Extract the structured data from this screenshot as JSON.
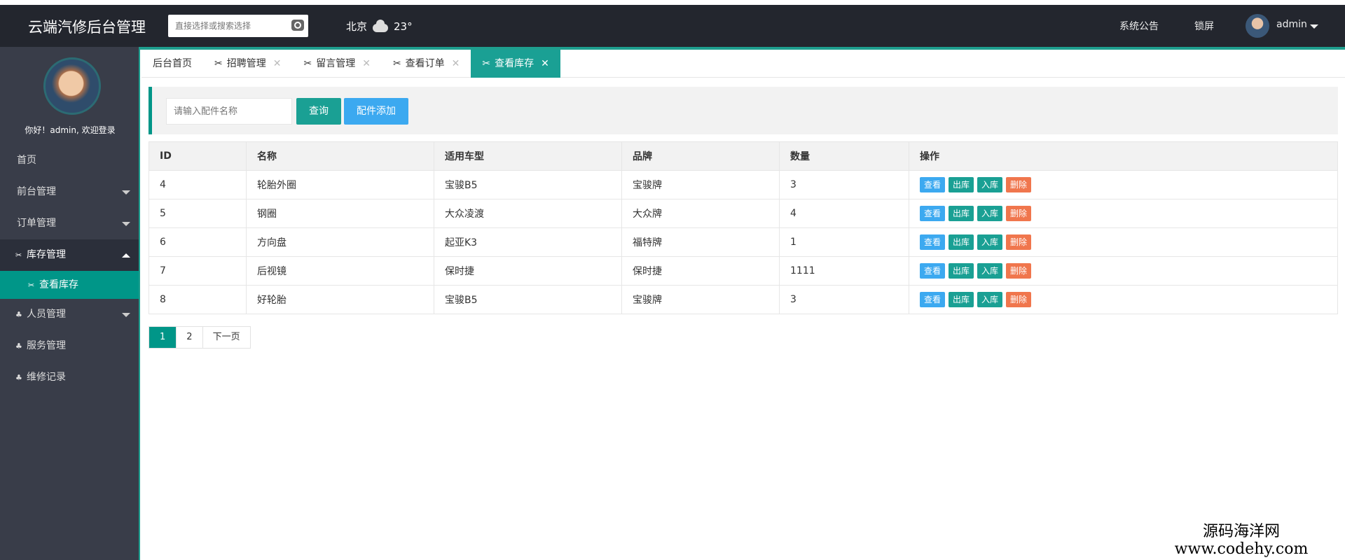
{
  "app": {
    "title": "云端汽修后台管理"
  },
  "header": {
    "search_placeholder": "直接选择或搜索选择",
    "weather": {
      "city": "北京",
      "temperature": "23°"
    },
    "notice_label": "系统公告",
    "lock_label": "锁屏",
    "user": "admin"
  },
  "sidebar": {
    "welcome": "你好！admin, 欢迎登录",
    "items": [
      {
        "label": "首页"
      },
      {
        "label": "前台管理"
      },
      {
        "label": "订单管理"
      },
      {
        "label": "库存管理"
      },
      {
        "label": "查看库存"
      },
      {
        "label": "人员管理"
      },
      {
        "label": "服务管理"
      },
      {
        "label": "维修记录"
      }
    ]
  },
  "tabs": [
    {
      "label": "后台首页"
    },
    {
      "label": "招聘管理"
    },
    {
      "label": "留言管理"
    },
    {
      "label": "查看订单"
    },
    {
      "label": "查看库存"
    }
  ],
  "toolbar": {
    "input_placeholder": "请输入配件名称",
    "query_label": "查询",
    "add_label": "配件添加"
  },
  "table": {
    "columns": [
      "ID",
      "名称",
      "适用车型",
      "品牌",
      "数量",
      "操作"
    ],
    "rows": [
      {
        "id": "4",
        "name": "轮胎外圈",
        "model": "宝骏B5",
        "brand": "宝骏牌",
        "qty": "3"
      },
      {
        "id": "5",
        "name": "钢圈",
        "model": "大众凌渡",
        "brand": "大众牌",
        "qty": "4"
      },
      {
        "id": "6",
        "name": "方向盘",
        "model": "起亚K3",
        "brand": "福特牌",
        "qty": "1"
      },
      {
        "id": "7",
        "name": "后视镜",
        "model": "保时捷",
        "brand": "保时捷",
        "qty": "1111"
      },
      {
        "id": "8",
        "name": "好轮胎",
        "model": "宝骏B5",
        "brand": "宝骏牌",
        "qty": "3"
      }
    ],
    "actions": {
      "view": "查看",
      "out": "出库",
      "in": "入库",
      "delete": "删除"
    }
  },
  "pagination": {
    "pages": [
      "1",
      "2"
    ],
    "next": "下一页",
    "current": "1"
  },
  "watermark": {
    "cn": "源码海洋网",
    "url": "www.codehy.com"
  },
  "colors": {
    "header_bg": "#23262e",
    "sidebar_bg": "#393d49",
    "accent": "#009688",
    "blue": "#3ca9f0",
    "danger": "#f0764d"
  }
}
